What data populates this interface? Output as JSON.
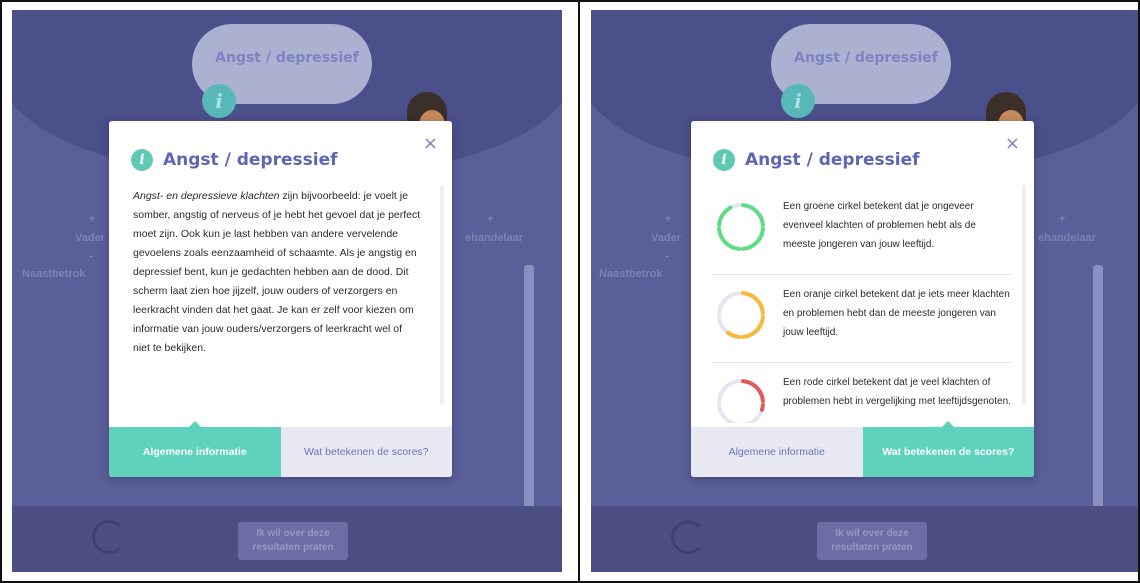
{
  "background": {
    "cloud_title": "Angst / depressief",
    "info_glyph": "i",
    "left_label_plus": "+",
    "left_label_1": "Vader",
    "left_label_minus": "-",
    "left_label_2": "Naastbetrok",
    "right_label_plus": "+",
    "right_label": "ehandelaar",
    "bottom_button": "Ik wil over deze resultaten praten"
  },
  "modal_info": {
    "title": "Angst / depressief",
    "icon": "i",
    "close": "×",
    "body_italic": "Angst- en depressieve klachten",
    "body_rest": " zijn bijvoorbeeld: je voelt je somber, angstig of nerveus of je hebt het gevoel dat je perfect moet zijn. Ook kun je last hebben van andere vervelende gevoelens zoals eenzaamheid of schaamte. Als je angstig en depressief bent, kun je gedachten hebben aan de dood. Dit scherm laat zien hoe jijzelf, jouw ouders of verzorgers en leerkracht vinden dat het gaat. Je kan er zelf voor kiezen om informatie van jouw ouders/verzorgers of leerkracht wel of niet te bekijken.",
    "tabs": [
      "Algemene informatie",
      "Wat betekenen de scores?"
    ],
    "active_tab": 0
  },
  "modal_scores": {
    "title": "Angst / depressief",
    "icon": "i",
    "close": "×",
    "items": [
      {
        "text": "Een groene cirkel betekent dat je ongeveer evenveel klachten of problemen hebt als de meeste jongeren van jouw leeftijd.",
        "color": "#5fdc84",
        "level": 0.92
      },
      {
        "text": "Een oranje cirkel betekent dat je iets meer klachten en problemen hebt dan de meeste jongeren van jouw leeftijd.",
        "color": "#f6b93b",
        "level": 0.6
      },
      {
        "text": "Een rode cirkel betekent dat je veel klachten of problemen hebt in vergelijking met leeftijdsgenoten.",
        "color": "#e05a5a",
        "level": 0.3
      }
    ],
    "tabs": [
      "Algemene informatie",
      "Wat betekenen de scores?"
    ],
    "active_tab": 1
  },
  "colors": {
    "background": "#5a5e99",
    "accent_teal": "#5fd2bd",
    "title_purple": "#5d66b4",
    "ring_track": "#e6e6f2"
  }
}
